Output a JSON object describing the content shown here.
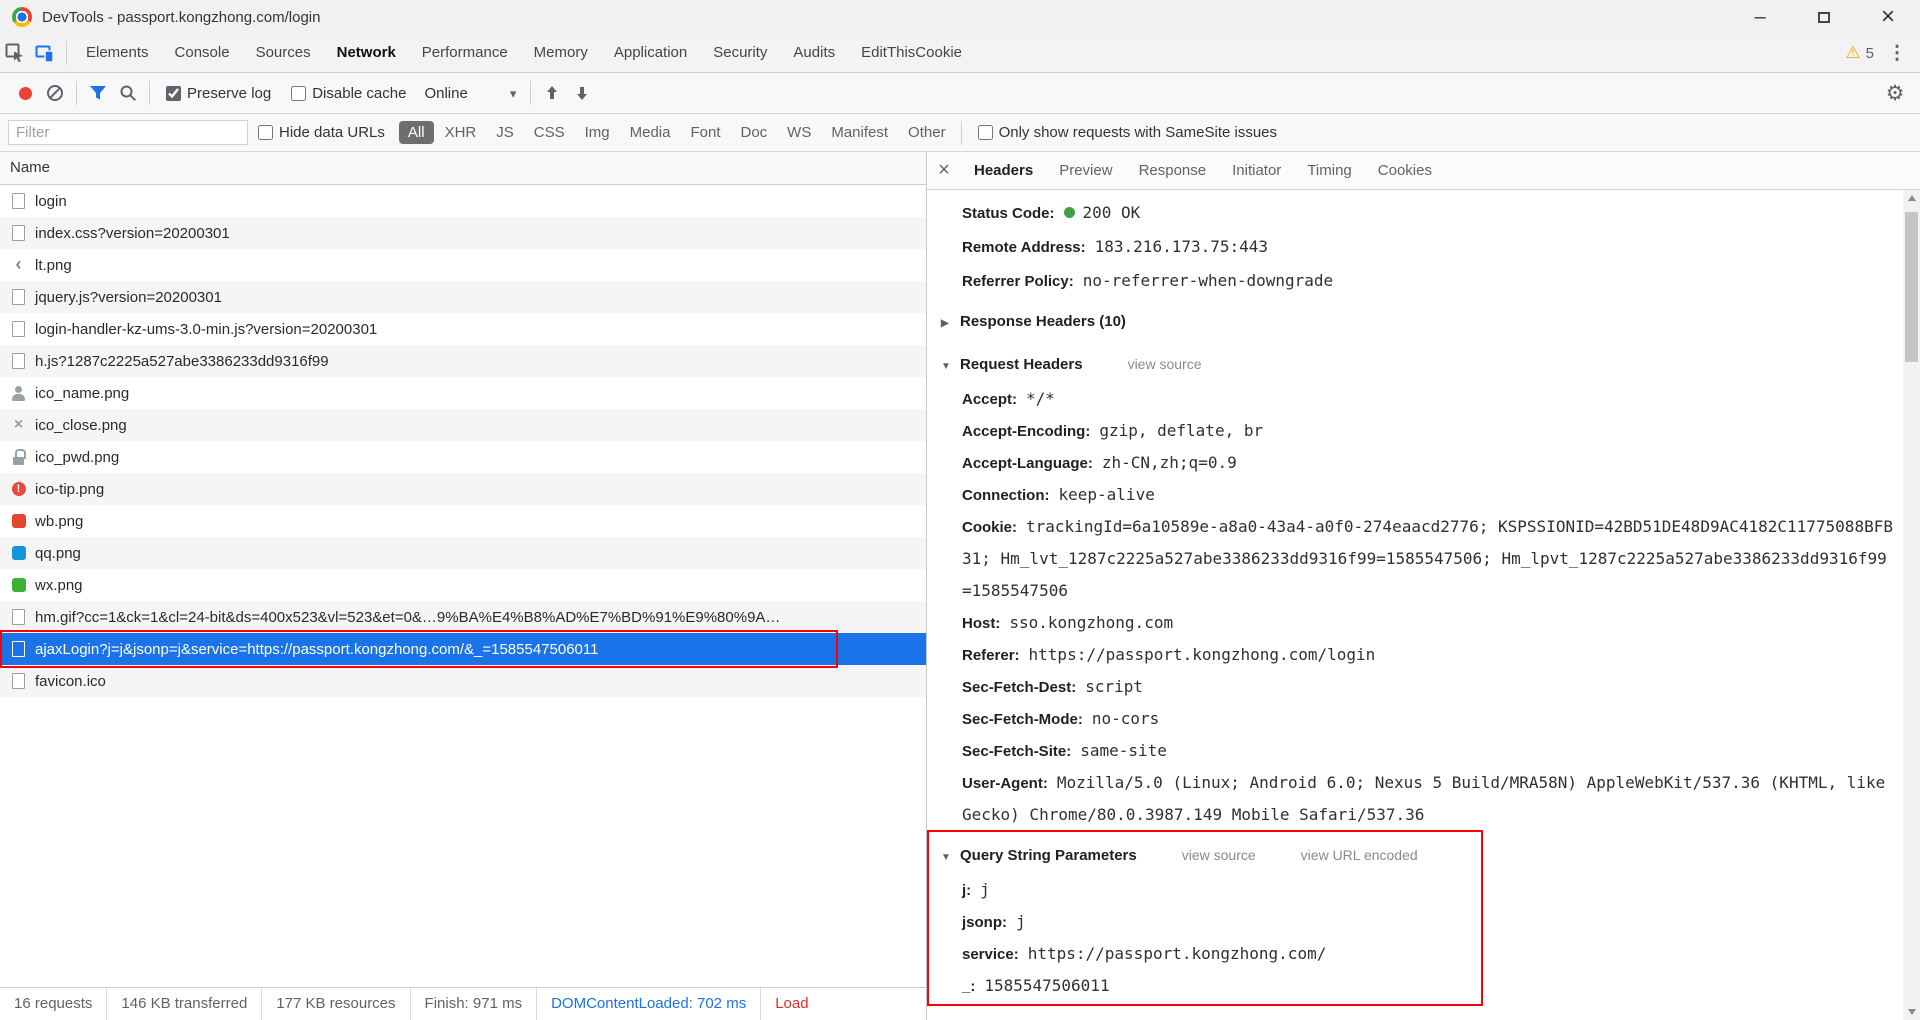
{
  "colors": {
    "accent_blue": "#1a73e8",
    "selection_blue": "#1a73e8",
    "record_red": "#ea4335",
    "status_green": "#43a047",
    "annotation_red": "#fb0007",
    "load_red": "#d93025",
    "warning_yellow": "#f0a500"
  },
  "window": {
    "title": "DevTools - passport.kongzhong.com/login"
  },
  "main_tabs": {
    "items": [
      "Elements",
      "Console",
      "Sources",
      "Network",
      "Performance",
      "Memory",
      "Application",
      "Security",
      "Audits",
      "EditThisCookie"
    ],
    "active_index": 3,
    "warning_count": "5"
  },
  "toolbar": {
    "preserve_log_label": "Preserve log",
    "preserve_log_checked": true,
    "disable_cache_label": "Disable cache",
    "disable_cache_checked": false,
    "throttling_value": "Online"
  },
  "filter_bar": {
    "placeholder": "Filter",
    "value": "",
    "hide_data_urls_label": "Hide data URLs",
    "hide_data_urls_checked": false,
    "chips": [
      "All",
      "XHR",
      "JS",
      "CSS",
      "Img",
      "Media",
      "Font",
      "Doc",
      "WS",
      "Manifest",
      "Other"
    ],
    "active_chip_index": 0,
    "samesite_label": "Only show requests with SameSite issues",
    "samesite_checked": false
  },
  "request_list": {
    "column_header": "Name",
    "rows": [
      {
        "name": "login",
        "icon": "document"
      },
      {
        "name": "index.css?version=20200301",
        "icon": "document"
      },
      {
        "name": "lt.png",
        "icon": "chevron"
      },
      {
        "name": "jquery.js?version=20200301",
        "icon": "document"
      },
      {
        "name": "login-handler-kz-ums-3.0-min.js?version=20200301",
        "icon": "document"
      },
      {
        "name": "h.js?1287c2225a527abe3386233dd9316f99",
        "icon": "document"
      },
      {
        "name": "ico_name.png",
        "icon": "person"
      },
      {
        "name": "ico_close.png",
        "icon": "close"
      },
      {
        "name": "ico_pwd.png",
        "icon": "lock"
      },
      {
        "name": "ico-tip.png",
        "icon": "alert"
      },
      {
        "name": "wb.png",
        "icon": "brand",
        "color": "#e6452d"
      },
      {
        "name": "qq.png",
        "icon": "brand",
        "color": "#1296db"
      },
      {
        "name": "wx.png",
        "icon": "brand",
        "color": "#3cb034"
      },
      {
        "name": "hm.gif?cc=1&ck=1&cl=24-bit&ds=400x523&vl=523&et=0&…9%BA%E4%B8%AD%E7%BD%91%E9%80%9A…",
        "icon": "document"
      },
      {
        "name": "ajaxLogin?j=j&jsonp=j&service=https://passport.kongzhong.com/&_=1585547506011",
        "icon": "document",
        "selected": true,
        "annotated": true
      },
      {
        "name": "favicon.ico",
        "icon": "document"
      }
    ]
  },
  "summary_bar": {
    "items": [
      {
        "text": "16 requests"
      },
      {
        "text": "146 KB transferred"
      },
      {
        "text": "177 KB resources"
      },
      {
        "text": "Finish: 971 ms"
      },
      {
        "text": "DOMContentLoaded: 702 ms",
        "style": "blue"
      },
      {
        "text": "Load",
        "style": "red"
      }
    ]
  },
  "detail_pane": {
    "tabs": [
      "Headers",
      "Preview",
      "Response",
      "Initiator",
      "Timing",
      "Cookies"
    ],
    "active_tab_index": 0,
    "general": [
      {
        "label": "Status Code:",
        "value": "200 OK",
        "dot": true
      },
      {
        "label": "Remote Address:",
        "value": "183.216.173.75:443"
      },
      {
        "label": "Referrer Policy:",
        "value": "no-referrer-when-downgrade"
      }
    ],
    "response_headers": {
      "title": "Response Headers (10)",
      "collapsed": true
    },
    "request_headers": {
      "title": "Request Headers",
      "links": [
        "view source"
      ],
      "items": [
        {
          "label": "Accept:",
          "value": "*/*"
        },
        {
          "label": "Accept-Encoding:",
          "value": "gzip, deflate, br"
        },
        {
          "label": "Accept-Language:",
          "value": "zh-CN,zh;q=0.9"
        },
        {
          "label": "Connection:",
          "value": "keep-alive"
        },
        {
          "label": "Cookie:",
          "value": "trackingId=6a10589e-a8a0-43a4-a0f0-274eaacd2776; KSPSSIONID=42BD51DE48D9AC4182C11775088BFB31; Hm_lvt_1287c2225a527abe3386233dd9316f99=1585547506; Hm_lpvt_1287c2225a527abe3386233dd9316f99=1585547506"
        },
        {
          "label": "Host:",
          "value": "sso.kongzhong.com"
        },
        {
          "label": "Referer:",
          "value": "https://passport.kongzhong.com/login"
        },
        {
          "label": "Sec-Fetch-Dest:",
          "value": "script"
        },
        {
          "label": "Sec-Fetch-Mode:",
          "value": "no-cors"
        },
        {
          "label": "Sec-Fetch-Site:",
          "value": "same-site"
        },
        {
          "label": "User-Agent:",
          "value": "Mozilla/5.0 (Linux; Android 6.0; Nexus 5 Build/MRA58N) AppleWebKit/537.36 (KHTML, like Gecko) Chrome/80.0.3987.149 Mobile Safari/537.36"
        }
      ]
    },
    "query_string": {
      "title": "Query String Parameters",
      "links": [
        "view source",
        "view URL encoded"
      ],
      "annotated": true,
      "items": [
        {
          "label": "j:",
          "value": "j"
        },
        {
          "label": "jsonp:",
          "value": "j"
        },
        {
          "label": "service:",
          "value": "https://passport.kongzhong.com/"
        },
        {
          "label": "_:",
          "value": "1585547506011"
        }
      ]
    }
  }
}
